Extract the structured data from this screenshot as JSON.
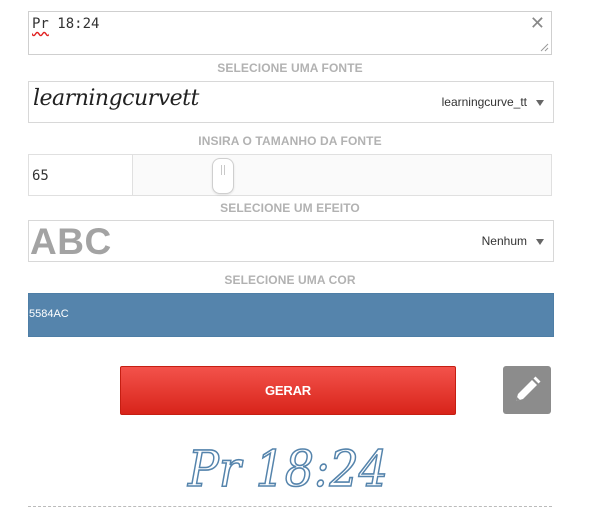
{
  "text_input": {
    "value_spellcheck": "Pr",
    "value_rest": " 18:24",
    "clear_glyph": "✕"
  },
  "font_section": {
    "label": "SELECIONE UMA FONTE",
    "preview_text": "learningcurvett",
    "selected": "learningcurve_tt"
  },
  "size_section": {
    "label": "INSIRA O TAMANHO DA FONTE",
    "value": "65"
  },
  "effect_section": {
    "label": "SELECIONE UM EFEITO",
    "preview_text": "ABC",
    "selected": "Nenhum"
  },
  "color_section": {
    "label": "SELECIONE UMA COR",
    "value": "5584AC",
    "color_hex": "#5584AC"
  },
  "actions": {
    "generate_label": "GERAR"
  },
  "result": {
    "text": "Pr 18:24",
    "color_hex": "#5584AC"
  },
  "colors": {
    "button_top": "#f3524b",
    "button_bottom": "#d8241a",
    "edit_bg": "#8c8c8c",
    "label_gray": "#b2b2b2"
  },
  "icons": {
    "clear": "close-icon",
    "dropdown": "caret-down-icon",
    "edit": "pencil-icon"
  }
}
